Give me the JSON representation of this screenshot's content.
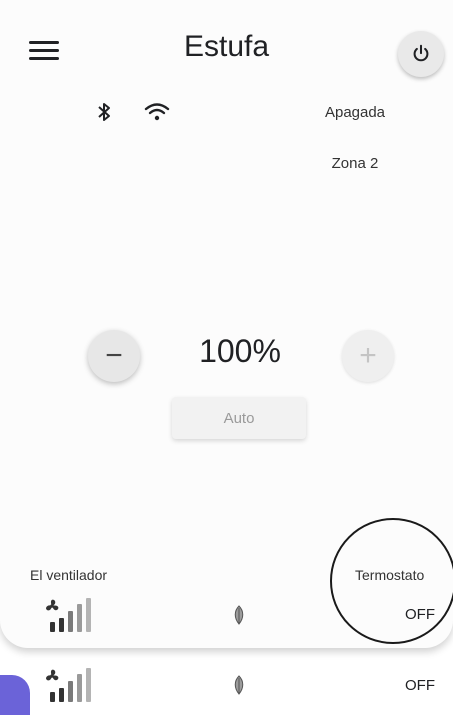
{
  "header": {
    "title": "Estufa",
    "menu_icon": "hamburger-menu-icon",
    "power_icon": "power-icon"
  },
  "status": {
    "bluetooth_icon": "bluetooth-icon",
    "wifi_icon": "wifi-icon",
    "state": "Apagada",
    "zone": "Zona 2"
  },
  "controls": {
    "minus_label": "−",
    "plus_label": "+",
    "power_level": "100%",
    "auto_label": "Auto"
  },
  "bottom": {
    "fan_label": "El ventilador",
    "thermostat_label": "Termostato",
    "fan_icon": "fan-speed-icon",
    "eco_icon": "leaf-icon",
    "row1": {
      "thermostat_value": "OFF"
    },
    "row2": {
      "thermostat_value": "OFF"
    }
  },
  "colors": {
    "accent": "#6b63d8",
    "card": "#fcfcfc",
    "text": "#202124",
    "muted": "#9a9a9a"
  }
}
